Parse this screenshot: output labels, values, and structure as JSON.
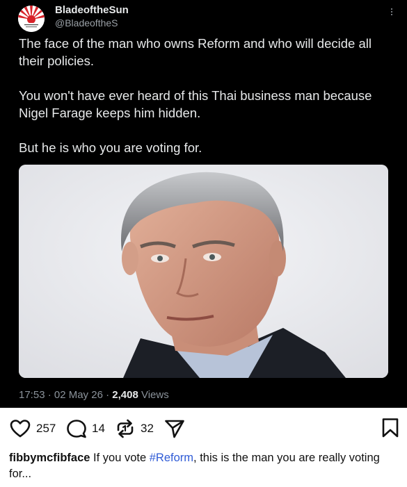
{
  "tweet": {
    "display_name": "BladeoftheSun",
    "handle": "@BladeoftheS",
    "paragraphs": [
      "The face of the man who owns Reform and who will decide all their policies.",
      "You won't have ever heard of this Thai business man because Nigel Farage keeps him hidden.",
      "But he is who you are voting for."
    ],
    "timestamp": "17:53 · 02 May 26 · ",
    "views_count": "2,408",
    "views_label": " Views"
  },
  "post_actions": {
    "likes": "257",
    "comments": "14",
    "reposts": "32"
  },
  "caption": {
    "username": "fibbymcfibface",
    "text_before": " If you vote ",
    "hashtag": "#Reform",
    "text_after": ", this is the man you are really voting for..."
  },
  "colors": {
    "tweet_bg": "#000000",
    "hashtag": "#2f5bd6",
    "avatar_accent": "#d8232a"
  }
}
